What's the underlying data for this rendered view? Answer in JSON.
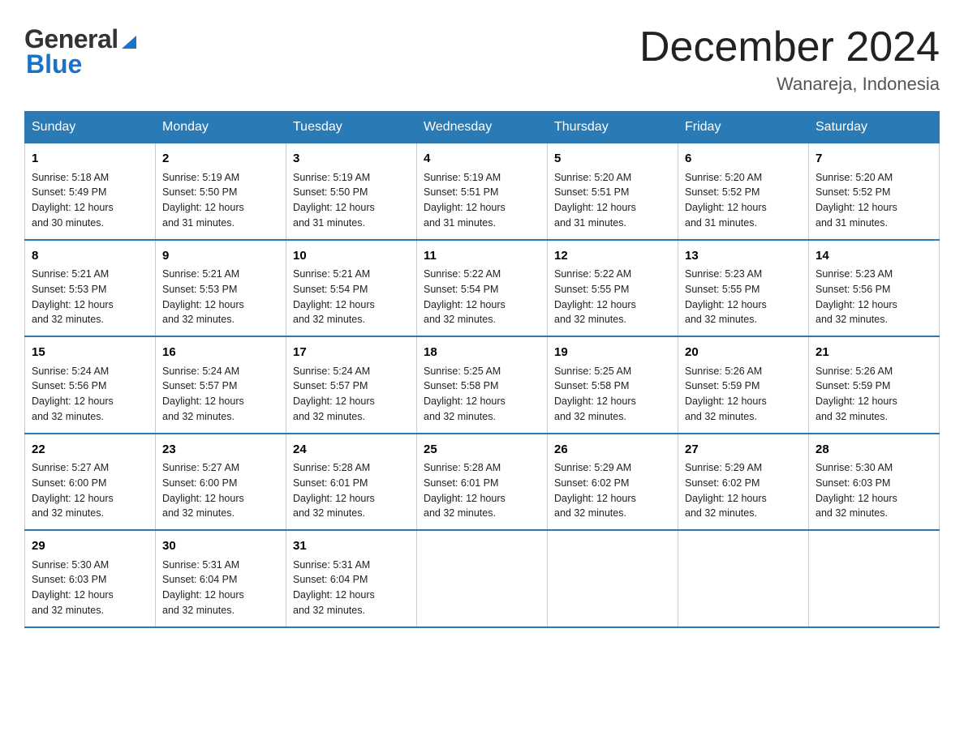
{
  "header": {
    "logo_general": "General",
    "logo_blue": "Blue",
    "month_year": "December 2024",
    "location": "Wanareja, Indonesia"
  },
  "days_of_week": [
    "Sunday",
    "Monday",
    "Tuesday",
    "Wednesday",
    "Thursday",
    "Friday",
    "Saturday"
  ],
  "weeks": [
    [
      {
        "num": "1",
        "sunrise": "5:18 AM",
        "sunset": "5:49 PM",
        "daylight": "12 hours and 30 minutes."
      },
      {
        "num": "2",
        "sunrise": "5:19 AM",
        "sunset": "5:50 PM",
        "daylight": "12 hours and 31 minutes."
      },
      {
        "num": "3",
        "sunrise": "5:19 AM",
        "sunset": "5:50 PM",
        "daylight": "12 hours and 31 minutes."
      },
      {
        "num": "4",
        "sunrise": "5:19 AM",
        "sunset": "5:51 PM",
        "daylight": "12 hours and 31 minutes."
      },
      {
        "num": "5",
        "sunrise": "5:20 AM",
        "sunset": "5:51 PM",
        "daylight": "12 hours and 31 minutes."
      },
      {
        "num": "6",
        "sunrise": "5:20 AM",
        "sunset": "5:52 PM",
        "daylight": "12 hours and 31 minutes."
      },
      {
        "num": "7",
        "sunrise": "5:20 AM",
        "sunset": "5:52 PM",
        "daylight": "12 hours and 31 minutes."
      }
    ],
    [
      {
        "num": "8",
        "sunrise": "5:21 AM",
        "sunset": "5:53 PM",
        "daylight": "12 hours and 32 minutes."
      },
      {
        "num": "9",
        "sunrise": "5:21 AM",
        "sunset": "5:53 PM",
        "daylight": "12 hours and 32 minutes."
      },
      {
        "num": "10",
        "sunrise": "5:21 AM",
        "sunset": "5:54 PM",
        "daylight": "12 hours and 32 minutes."
      },
      {
        "num": "11",
        "sunrise": "5:22 AM",
        "sunset": "5:54 PM",
        "daylight": "12 hours and 32 minutes."
      },
      {
        "num": "12",
        "sunrise": "5:22 AM",
        "sunset": "5:55 PM",
        "daylight": "12 hours and 32 minutes."
      },
      {
        "num": "13",
        "sunrise": "5:23 AM",
        "sunset": "5:55 PM",
        "daylight": "12 hours and 32 minutes."
      },
      {
        "num": "14",
        "sunrise": "5:23 AM",
        "sunset": "5:56 PM",
        "daylight": "12 hours and 32 minutes."
      }
    ],
    [
      {
        "num": "15",
        "sunrise": "5:24 AM",
        "sunset": "5:56 PM",
        "daylight": "12 hours and 32 minutes."
      },
      {
        "num": "16",
        "sunrise": "5:24 AM",
        "sunset": "5:57 PM",
        "daylight": "12 hours and 32 minutes."
      },
      {
        "num": "17",
        "sunrise": "5:24 AM",
        "sunset": "5:57 PM",
        "daylight": "12 hours and 32 minutes."
      },
      {
        "num": "18",
        "sunrise": "5:25 AM",
        "sunset": "5:58 PM",
        "daylight": "12 hours and 32 minutes."
      },
      {
        "num": "19",
        "sunrise": "5:25 AM",
        "sunset": "5:58 PM",
        "daylight": "12 hours and 32 minutes."
      },
      {
        "num": "20",
        "sunrise": "5:26 AM",
        "sunset": "5:59 PM",
        "daylight": "12 hours and 32 minutes."
      },
      {
        "num": "21",
        "sunrise": "5:26 AM",
        "sunset": "5:59 PM",
        "daylight": "12 hours and 32 minutes."
      }
    ],
    [
      {
        "num": "22",
        "sunrise": "5:27 AM",
        "sunset": "6:00 PM",
        "daylight": "12 hours and 32 minutes."
      },
      {
        "num": "23",
        "sunrise": "5:27 AM",
        "sunset": "6:00 PM",
        "daylight": "12 hours and 32 minutes."
      },
      {
        "num": "24",
        "sunrise": "5:28 AM",
        "sunset": "6:01 PM",
        "daylight": "12 hours and 32 minutes."
      },
      {
        "num": "25",
        "sunrise": "5:28 AM",
        "sunset": "6:01 PM",
        "daylight": "12 hours and 32 minutes."
      },
      {
        "num": "26",
        "sunrise": "5:29 AM",
        "sunset": "6:02 PM",
        "daylight": "12 hours and 32 minutes."
      },
      {
        "num": "27",
        "sunrise": "5:29 AM",
        "sunset": "6:02 PM",
        "daylight": "12 hours and 32 minutes."
      },
      {
        "num": "28",
        "sunrise": "5:30 AM",
        "sunset": "6:03 PM",
        "daylight": "12 hours and 32 minutes."
      }
    ],
    [
      {
        "num": "29",
        "sunrise": "5:30 AM",
        "sunset": "6:03 PM",
        "daylight": "12 hours and 32 minutes."
      },
      {
        "num": "30",
        "sunrise": "5:31 AM",
        "sunset": "6:04 PM",
        "daylight": "12 hours and 32 minutes."
      },
      {
        "num": "31",
        "sunrise": "5:31 AM",
        "sunset": "6:04 PM",
        "daylight": "12 hours and 32 minutes."
      },
      {
        "num": "",
        "sunrise": "",
        "sunset": "",
        "daylight": ""
      },
      {
        "num": "",
        "sunrise": "",
        "sunset": "",
        "daylight": ""
      },
      {
        "num": "",
        "sunrise": "",
        "sunset": "",
        "daylight": ""
      },
      {
        "num": "",
        "sunrise": "",
        "sunset": "",
        "daylight": ""
      }
    ]
  ],
  "labels": {
    "sunrise_prefix": "Sunrise: ",
    "sunset_prefix": "Sunset: ",
    "daylight_prefix": "Daylight: "
  }
}
